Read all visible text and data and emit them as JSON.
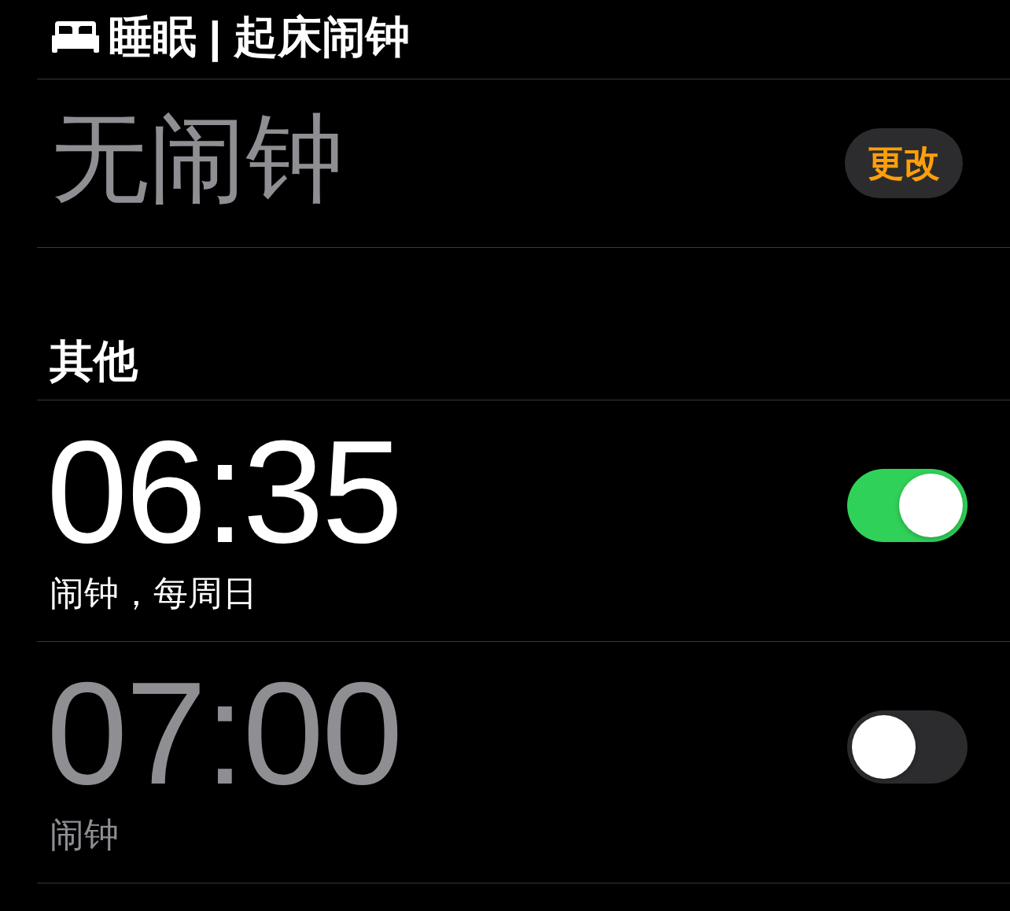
{
  "sleep_section": {
    "title": "睡眠 | 起床闹钟",
    "status": "无闹钟",
    "change_button": "更改"
  },
  "other_section": {
    "title": "其他"
  },
  "alarms": [
    {
      "time": "06:35",
      "label": "闹钟，每周日",
      "on": true
    },
    {
      "time": "07:00",
      "label": "闹钟",
      "on": false
    }
  ]
}
